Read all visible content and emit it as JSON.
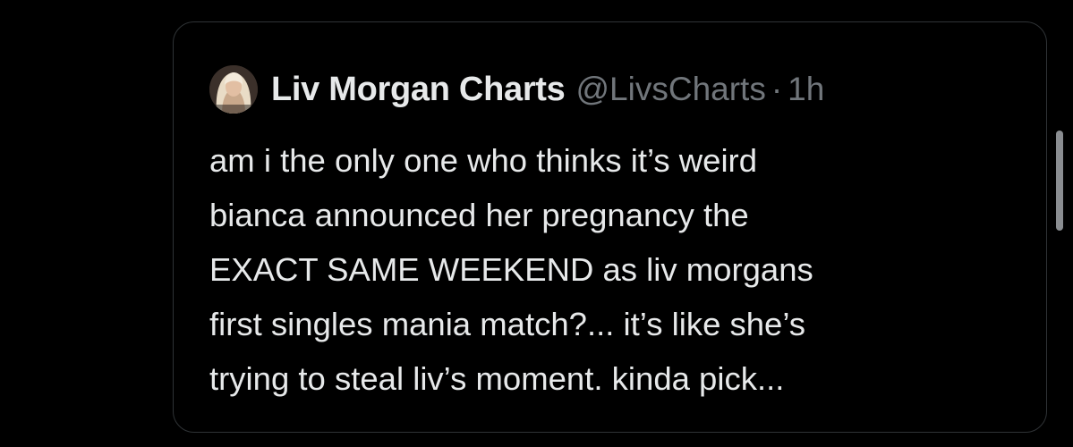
{
  "quoted_tweet": {
    "author": {
      "display_name": "Liv Morgan Charts",
      "handle": "@LivsCharts",
      "avatar_icon": "profile-photo-avatar"
    },
    "separator": "·",
    "time": "1h",
    "text_lines": [
      "am i the only one who thinks it’s weird",
      "bianca announced her pregnancy the",
      "EXACT SAME WEEKEND as liv morgans",
      "first singles mania match?... it’s like she’s",
      "trying to steal liv’s moment. kinda pick..."
    ]
  },
  "colors": {
    "background": "#000000",
    "card_border": "#2f3336",
    "primary_text": "#e7e9ea",
    "secondary_text": "#71767b",
    "scrollbar": "#8a8d91"
  }
}
